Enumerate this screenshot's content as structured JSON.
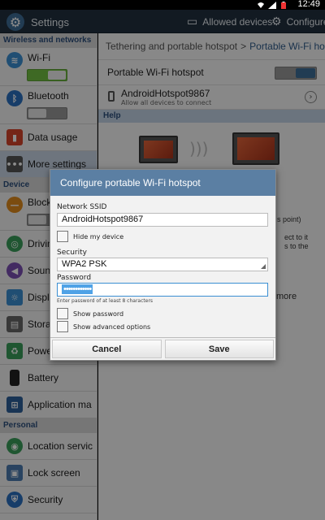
{
  "status": {
    "time": "12:49"
  },
  "actionbar": {
    "title": "Settings",
    "allowed_devices": "Allowed devices",
    "configure": "Configure"
  },
  "sidebar": {
    "sections": {
      "wireless": "Wireless and networks",
      "device": "Device",
      "personal": "Personal"
    },
    "items": {
      "wifi": "Wi-Fi",
      "bluetooth": "Bluetooth",
      "data_usage": "Data usage",
      "more_settings": "More settings",
      "blocking": "Block",
      "driving": "Drivin",
      "sound": "Soun",
      "display": "Displ",
      "storage": "Stora",
      "power": "Powe",
      "battery": "Battery",
      "application": "Application ma",
      "location": "Location servic",
      "lock_screen": "Lock screen",
      "security": "Security"
    },
    "wifi_on": true,
    "bluetooth_on": false,
    "blocking_on": false
  },
  "main": {
    "breadcrumb": {
      "parent": "Tethering and portable hotspot",
      "separator": ">",
      "current": "Portable Wi-Fi ho"
    },
    "hotspot_label": "Portable Wi-Fi hotspot",
    "hotspot_on": true,
    "device_name": "AndroidHotspot9867",
    "device_sub": "Allow all devices to connect",
    "help": "Help",
    "help_frags": {
      "a": "s point)",
      "b": "ect to it",
      "c": "s to the",
      "more": "more"
    }
  },
  "dialog": {
    "title": "Configure portable Wi-Fi hotspot",
    "ssid_label": "Network SSID",
    "ssid_value": "AndroidHotspot9867",
    "hide_device": "Hide my device",
    "security_label": "Security",
    "security_value": "WPA2 PSK",
    "password_label": "Password",
    "password_value": "••••••••••••",
    "password_hint": "Enter password of at least 8 characters",
    "show_password": "Show password",
    "show_advanced": "Show advanced options",
    "cancel": "Cancel",
    "save": "Save"
  },
  "colors": {
    "actionbar": "#22303f",
    "dialog_title": "#5b7fa3",
    "accent": "#4fa2e6",
    "toggle_on": "#71c043"
  }
}
